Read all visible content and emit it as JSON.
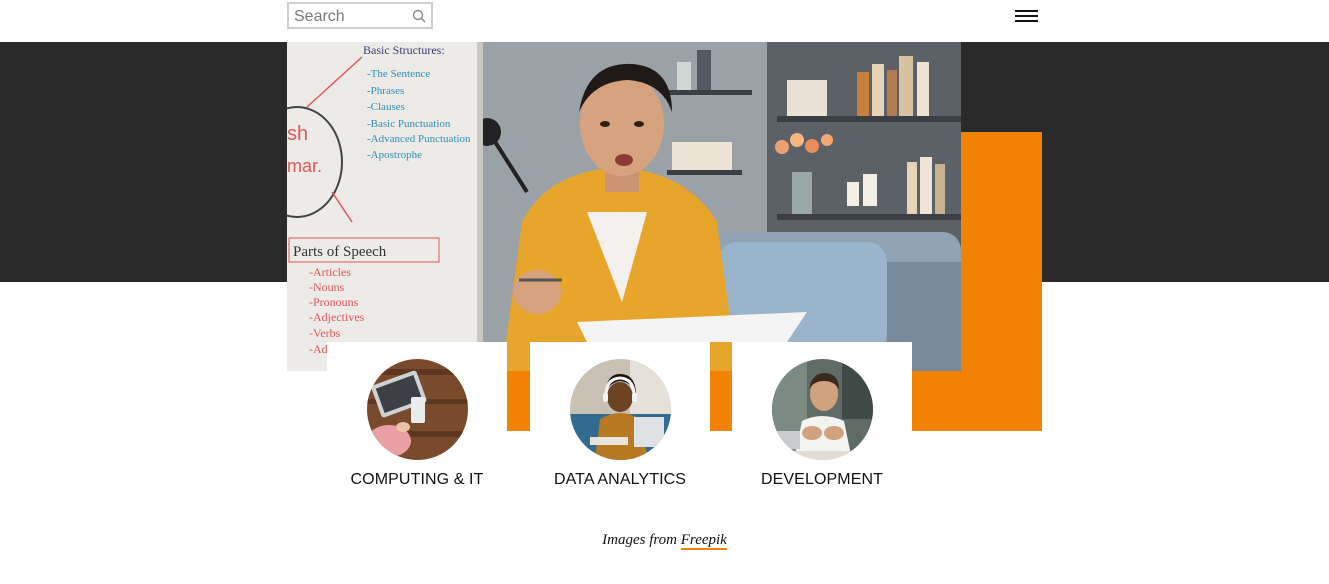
{
  "header": {
    "search": {
      "placeholder": "Search",
      "value": "",
      "icon": "search-icon"
    },
    "menu_icon": "hamburger-menu-icon"
  },
  "hero": {
    "image_description_icon": "hero-photo",
    "whiteboard": {
      "heading": "Basic Structures:",
      "items": [
        "The Sentence",
        "Phrases",
        "Clauses",
        "Basic Punctuation",
        "Advanced Punctuation",
        "Apostrophe"
      ],
      "side_words": [
        "sh",
        "mar."
      ],
      "section2_heading": "Parts of Speech",
      "section2_items": [
        "Articles",
        "Nouns",
        "Pronouns",
        "Adjectives",
        "Verbs",
        "Ad"
      ]
    }
  },
  "colors": {
    "accent": "#f28203",
    "dark_band": "#2a2a2a",
    "text": "#111111"
  },
  "categories": [
    {
      "label": "COMPUTING & IT",
      "image": "laptop-top-view-photo"
    },
    {
      "label": "DATA ANALYTICS",
      "image": "student-with-headphones-photo"
    },
    {
      "label": "DEVELOPMENT",
      "image": "smiling-man-at-laptop-photo"
    }
  ],
  "credit": {
    "prefix": "Images from ",
    "link_text": "Freepik"
  }
}
